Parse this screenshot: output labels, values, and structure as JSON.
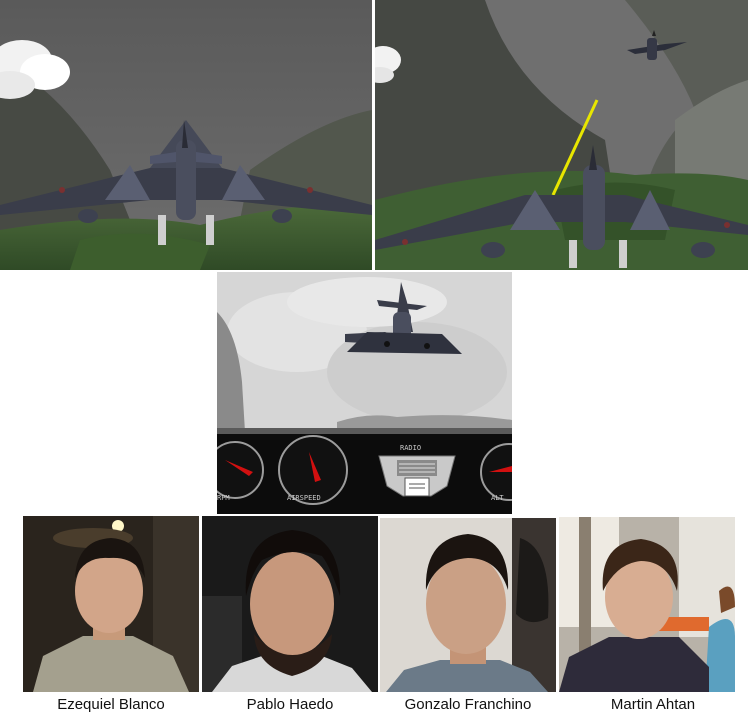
{
  "hud": {
    "gauge_rpm": "RPM",
    "gauge_airspeed": "AIRSPEED",
    "gauge_radio": "RADIO",
    "gauge_alt": "ALT"
  },
  "people": [
    {
      "name": "Ezequiel Blanco"
    },
    {
      "name": "Pablo Haedo"
    },
    {
      "name": "Gonzalo Franchino"
    },
    {
      "name": "Martin Ahtan"
    }
  ]
}
